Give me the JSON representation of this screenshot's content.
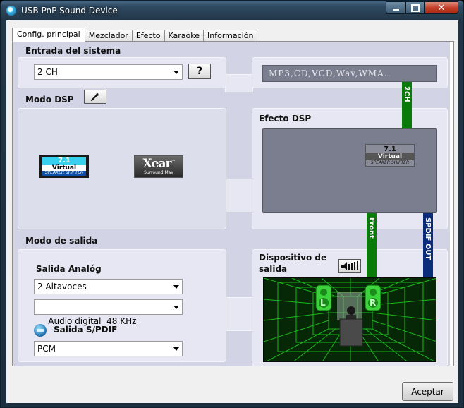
{
  "window": {
    "title": "USB PnP Sound Device",
    "close_glyph": "✕"
  },
  "tabs": [
    {
      "label": "Config. principal",
      "active": true
    },
    {
      "label": "Mezclador"
    },
    {
      "label": "Efecto"
    },
    {
      "label": "Karaoke"
    },
    {
      "label": "Información"
    }
  ],
  "system_input": {
    "title": "Entrada del sistema",
    "channel_value": "2 CH",
    "help_label": "?",
    "display_text": "MP3,CD,VCD,Wav,WMA.."
  },
  "dsp_mode": {
    "title": "Modo DSP",
    "logo_71": {
      "top": "7.1",
      "mid": "Virtual",
      "bottom": "SPEAKER SHIFTER"
    },
    "logo_xear": {
      "brand": "Xear",
      "tm": "™",
      "sub": "Surround Max"
    }
  },
  "dsp_effect": {
    "title": "Efecto DSP",
    "logo_71": {
      "top": "7.1",
      "mid": "Virtual",
      "bottom": "SPEAKER SHIFTER"
    }
  },
  "signal_bars": {
    "top": "2CH",
    "front": "Front",
    "spdif": "SPDIF OUT"
  },
  "output_mode": {
    "title": "Modo de salida",
    "analog_title": "Salida Analóg",
    "speakers_value": "2 Altavoces",
    "digital_value": "Audio digital  48 KHz",
    "spdif_title": "Salida S/PDIF",
    "spdif_value": "PCM"
  },
  "output_device": {
    "title_line1": "Dispositivo de",
    "title_line2": "salida",
    "left_label": "L",
    "right_label": "R"
  },
  "footer": {
    "accept_label": "Aceptar"
  },
  "colors": {
    "bar_green": "#0a7a0a",
    "bar_blue": "#0b2c7a",
    "accent_cyan": "#37d1ef",
    "room_green": "#1fd01f"
  }
}
